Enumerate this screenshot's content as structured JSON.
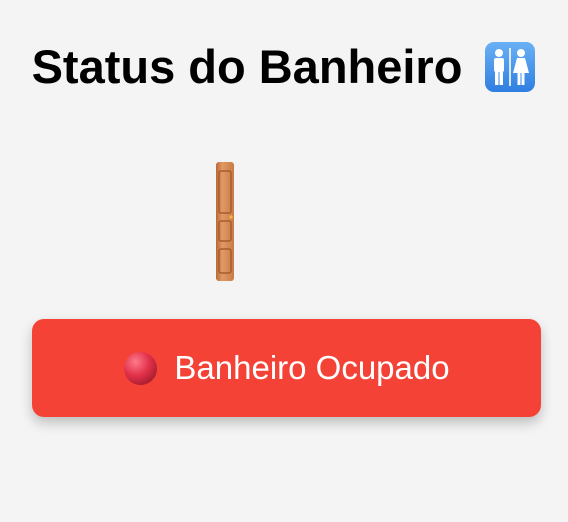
{
  "header": {
    "title": "Status do Banheiro",
    "icon": "restroom-icon"
  },
  "door": {
    "icon": "door-icon",
    "color": "#d98a50"
  },
  "status": {
    "label": "Banheiro Ocupado",
    "icon": "red-circle-icon",
    "color": "#f44336"
  }
}
